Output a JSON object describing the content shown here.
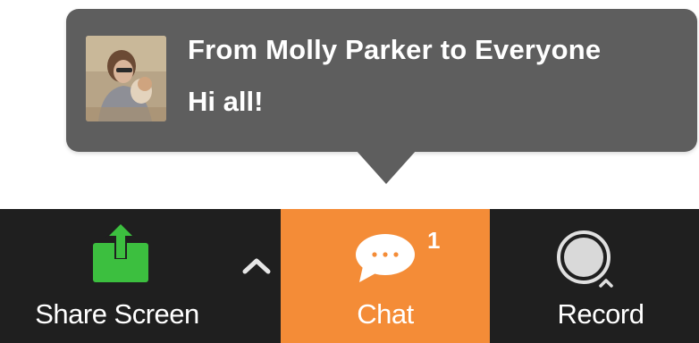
{
  "notification": {
    "sender_line": "From Molly Parker to Everyone",
    "message": "Hi all!",
    "background_color": "#5e5e5e",
    "avatar_icon": "user-photo"
  },
  "toolbar": {
    "background_color": "#1f1f1f",
    "share_screen": {
      "label": "Share Screen",
      "icon": "share-screen-upload-icon",
      "icon_color": "#3cbf3f"
    },
    "share_options": {
      "icon": "chevron-up-icon"
    },
    "chat": {
      "label": "Chat",
      "badge_count": "1",
      "icon": "chat-bubble-icon",
      "active_color": "#f48c37"
    },
    "record": {
      "label": "Record",
      "icon": "record-circle-icon"
    }
  }
}
